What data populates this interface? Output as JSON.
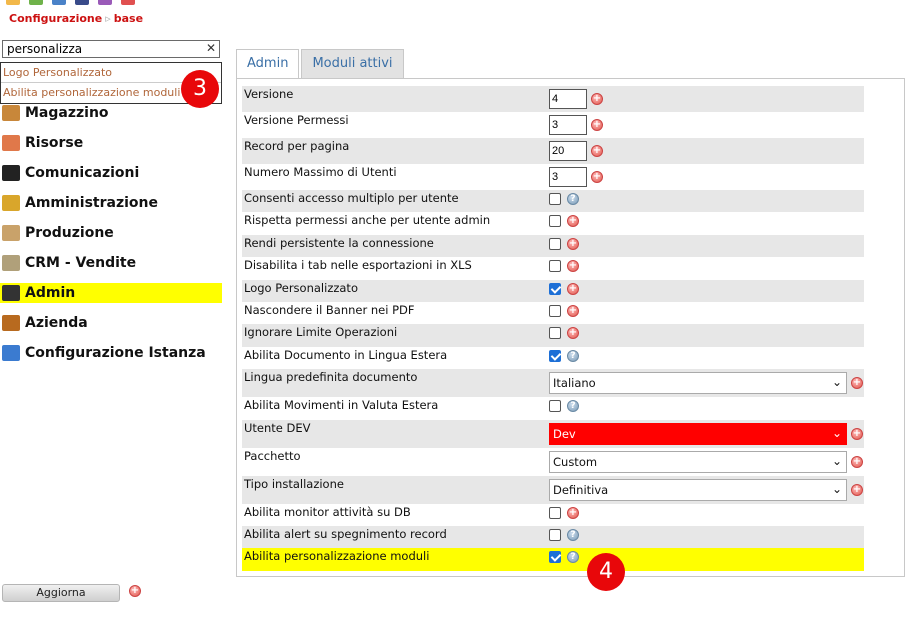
{
  "breadcrumb": {
    "root": "Configurazione",
    "current": "base"
  },
  "search": {
    "value": "personalizza"
  },
  "suggestions": [
    "Logo Personalizzato",
    "Abilita personalizzazione moduli"
  ],
  "badges": {
    "first": "3",
    "second": "4"
  },
  "menu": [
    {
      "label": "Magazzino",
      "icon": "warehouse-icon",
      "color": "#c8873a"
    },
    {
      "label": "Risorse",
      "icon": "calendar-icon",
      "color": "#e0784a"
    },
    {
      "label": "Comunicazioni",
      "icon": "document-icon",
      "color": "#222222"
    },
    {
      "label": "Amministrazione",
      "icon": "coins-icon",
      "color": "#d9a62b"
    },
    {
      "label": "Produzione",
      "icon": "clipboard-icon",
      "color": "#c9a26a"
    },
    {
      "label": "CRM - Vendite",
      "icon": "clipboard-icon",
      "color": "#b0a07a"
    },
    {
      "label": "Admin",
      "icon": "user-icon",
      "color": "#333333"
    },
    {
      "label": "Azienda",
      "icon": "briefcase-icon",
      "color": "#b86a1f"
    },
    {
      "label": "Configurazione Istanza",
      "icon": "blocks-icon",
      "color": "#3b7bd0"
    }
  ],
  "refresh_button": "Aggiorna",
  "tabs": [
    "Admin",
    "Moduli attivi"
  ],
  "settings": [
    {
      "label": "Versione",
      "type": "number",
      "value": "4",
      "action": "plus"
    },
    {
      "label": "Versione Permessi",
      "type": "number",
      "value": "3",
      "action": "plus"
    },
    {
      "label": "Record per pagina",
      "type": "number",
      "value": "20",
      "action": "plus"
    },
    {
      "label": "Numero Massimo di Utenti",
      "type": "number",
      "value": "3",
      "action": "plus"
    },
    {
      "label": "Consenti accesso multiplo per utente",
      "type": "checkbox",
      "checked": false,
      "action": "help"
    },
    {
      "label": "Rispetta permessi anche per utente admin",
      "type": "checkbox",
      "checked": false,
      "action": "plus"
    },
    {
      "label": "Rendi persistente la connessione",
      "type": "checkbox",
      "checked": false,
      "action": "plus"
    },
    {
      "label": "Disabilita i tab nelle esportazioni in XLS",
      "type": "checkbox",
      "checked": false,
      "action": "plus"
    },
    {
      "label": "Logo Personalizzato",
      "type": "checkbox",
      "checked": true,
      "action": "plus"
    },
    {
      "label": "Nascondere il Banner nei PDF",
      "type": "checkbox",
      "checked": false,
      "action": "plus"
    },
    {
      "label": "Ignorare Limite Operazioni",
      "type": "checkbox",
      "checked": false,
      "action": "plus"
    },
    {
      "label": "Abilita Documento in Lingua Estera",
      "type": "checkbox",
      "checked": true,
      "action": "help"
    },
    {
      "label": "Lingua predefinita documento",
      "type": "select",
      "value": "Italiano",
      "action": "plus"
    },
    {
      "label": "Abilita Movimenti in Valuta Estera",
      "type": "checkbox",
      "checked": false,
      "action": "help"
    },
    {
      "label": "Utente DEV",
      "type": "select",
      "value": "Dev",
      "red": true,
      "action": "plus"
    },
    {
      "label": "Pacchetto",
      "type": "select",
      "value": "Custom",
      "action": "plus"
    },
    {
      "label": "Tipo installazione",
      "type": "select",
      "value": "Definitiva",
      "action": "plus"
    },
    {
      "label": "Abilita monitor attività su DB",
      "type": "checkbox",
      "checked": false,
      "action": "plus"
    },
    {
      "label": "Abilita alert su spegnimento record",
      "type": "checkbox",
      "checked": false,
      "action": "help"
    },
    {
      "label": "Abilita personalizzazione moduli",
      "type": "checkbox",
      "checked": true,
      "action": "help",
      "highlight": true
    }
  ],
  "colors": {
    "accent": "#cc1111",
    "highlight": "#ffff00",
    "badge": "#e8070a",
    "checkbox": "#1d6fd6"
  }
}
